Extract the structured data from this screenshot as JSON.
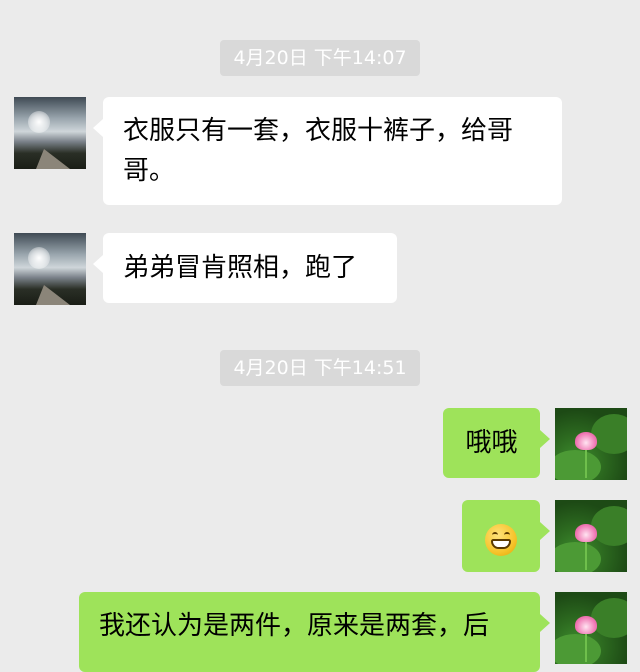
{
  "timestamps": [
    "4月20日 下午14:07",
    "4月20日 下午14:51"
  ],
  "messages": [
    {
      "side": "incoming",
      "text": "衣服只有一套，衣服十裤子，给哥哥。"
    },
    {
      "side": "incoming",
      "text": "弟弟冒肯照相，跑了"
    },
    {
      "side": "outgoing",
      "text": "哦哦"
    },
    {
      "side": "outgoing",
      "emoji": "grinning-face-emoji"
    },
    {
      "side": "outgoing",
      "text": "我还认为是两件，原来是两套，后"
    }
  ],
  "avatars": {
    "contact": "landscape-road-avatar",
    "self": "lotus-flower-avatar"
  },
  "colors": {
    "background": "#ebebeb",
    "incoming_bubble": "#ffffff",
    "outgoing_bubble": "#9ee35a",
    "timestamp_bg": "#d9d9d9"
  }
}
